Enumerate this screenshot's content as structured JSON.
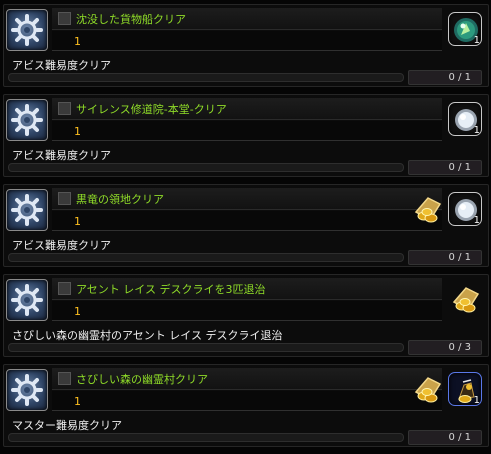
{
  "quests": [
    {
      "title": "沈没した貨物船クリア",
      "count": "1",
      "objective": "アビス難易度クリア",
      "progress_text": "0 / 1",
      "progress": 0,
      "rewards": [
        {
          "icon": "green-orb-icon",
          "qty": "1"
        }
      ]
    },
    {
      "title": "サイレンス修道院-本堂-クリア",
      "count": "1",
      "objective": "アビス難易度クリア",
      "progress_text": "0 / 1",
      "progress": 0,
      "rewards": [
        {
          "icon": "white-orb-icon",
          "qty": "1"
        }
      ]
    },
    {
      "title": "黒竜の領地クリア",
      "count": "1",
      "objective": "アビス難易度クリア",
      "progress_text": "0 / 1",
      "progress": 0,
      "rewards": [
        {
          "icon": "gold-coins-icon",
          "qty": ""
        },
        {
          "icon": "white-orb-icon",
          "qty": "1"
        }
      ]
    },
    {
      "title": "アセント レイス デスクライを3匹退治",
      "count": "1",
      "objective": "さびしい森の幽霊村のアセント レイス デスクライ退治",
      "progress_text": "0 / 3",
      "progress": 0,
      "rewards": [
        {
          "icon": "gold-coins-icon",
          "qty": ""
        }
      ]
    },
    {
      "title": "さびしい森の幽霊村クリア",
      "count": "1",
      "objective": "マスター難易度クリア",
      "progress_text": "0 / 1",
      "progress": 0,
      "rewards": [
        {
          "icon": "gold-coins-icon",
          "qty": ""
        },
        {
          "icon": "gold-pouch-icon",
          "qty": "1"
        }
      ]
    }
  ]
}
